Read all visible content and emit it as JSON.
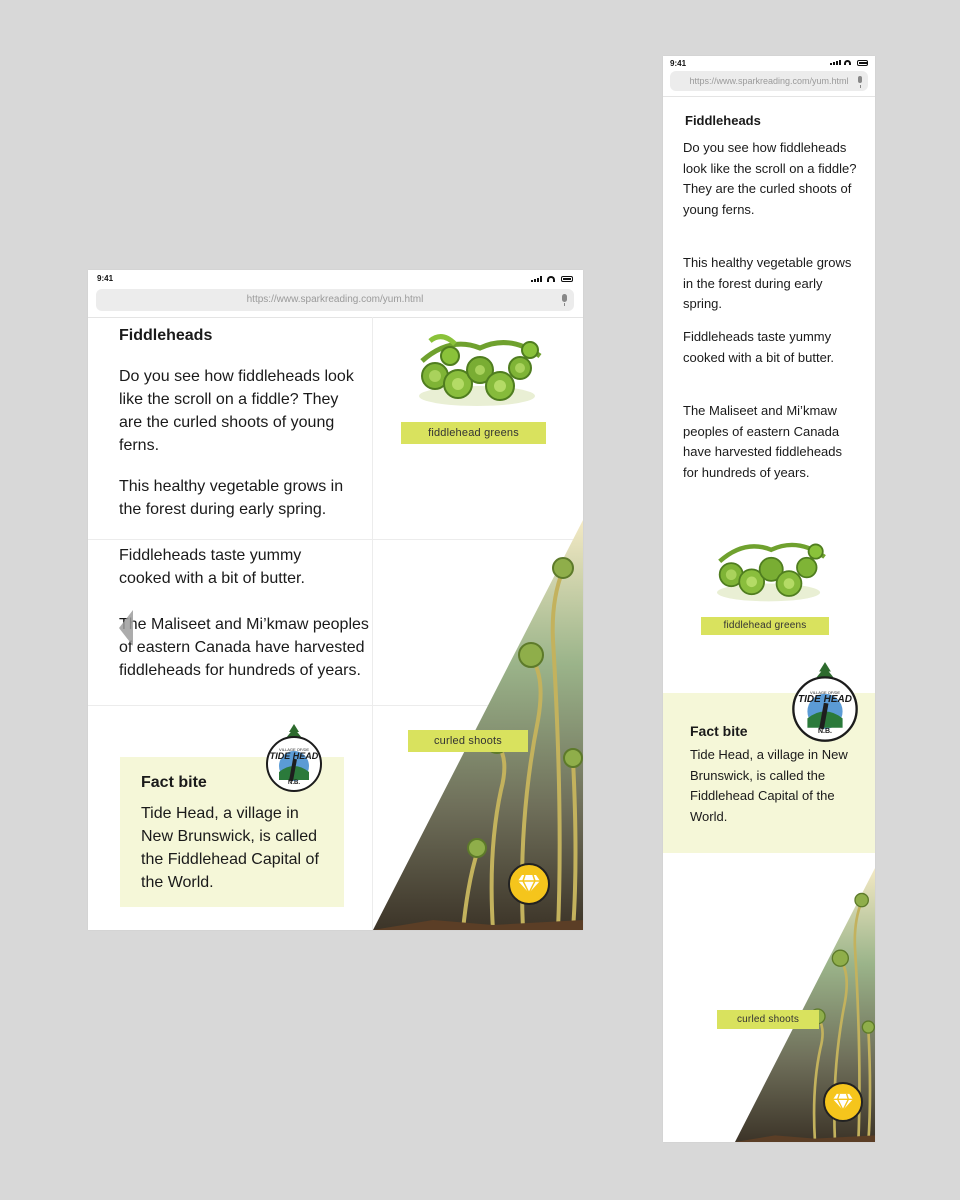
{
  "status": {
    "time": "9:41"
  },
  "browser": {
    "url": "https://www.sparkreading.com/yum.html"
  },
  "article": {
    "title": "Fiddleheads",
    "p1": "Do you see how fiddleheads look like the scroll on a fiddle? They are the curled shoots of young ferns.",
    "p2": "This healthy vegetable grows in the forest during early spring.",
    "p3": "Fiddleheads taste yummy cooked with a bit of butter.",
    "p4": "The Maliseet and Mi’kmaw peoples of eastern Canada have harvested fiddleheads for hundreds of years."
  },
  "images": {
    "greens_label": "fiddlehead greens",
    "shoots_label": "curled shoots"
  },
  "fact": {
    "title": "Fact bite",
    "body": "Tide Head, a village in New Brunswick, is called the Fiddlehead Capital of the World."
  },
  "logo": {
    "top": "VILLAGE OF/DE",
    "main": "TIDE HEAD",
    "bottom": "N.B."
  },
  "icons": {
    "gem": "gem-icon",
    "back": "chevron-left-icon",
    "next": "chevron-right-icon",
    "mic": "mic-icon"
  },
  "colors": {
    "label_bg": "#d9e25e",
    "fact_bg": "#f5f7d8",
    "gem_bg": "#f5c51c",
    "background": "#d8d8d8"
  }
}
